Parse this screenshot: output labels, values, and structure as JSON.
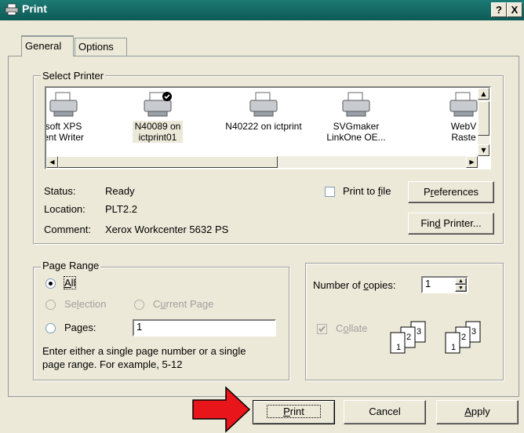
{
  "window": {
    "title": "Print",
    "help_label": "?",
    "close_label": "X"
  },
  "tabs": [
    {
      "label": "General"
    },
    {
      "label": "Options"
    }
  ],
  "select_printer": {
    "legend": "Select Printer",
    "printers": [
      {
        "line1": "soft XPS",
        "line2": "ent Writer",
        "icon": "printer-icon"
      },
      {
        "line1": "N40089 on",
        "line2": "ictprint01",
        "icon": "default-printer-icon",
        "selected": true
      },
      {
        "line1": "N40222 on ictprint",
        "line2": "",
        "icon": "printer-icon"
      },
      {
        "line1": "SVGmaker",
        "line2": "LinkOne OE...",
        "icon": "printer-icon"
      },
      {
        "line1": "WebV",
        "line2": "Raste",
        "icon": "printer-icon"
      }
    ],
    "status_label": "Status:",
    "status_value": "Ready",
    "location_label": "Location:",
    "location_value": "PLT2.2",
    "comment_label": "Comment:",
    "comment_value": "Xerox Workcenter 5632 PS",
    "print_to_file_pre": "Print to ",
    "print_to_file_key": "f",
    "print_to_file_post": "ile",
    "preferences_pre": "P",
    "preferences_key": "r",
    "preferences_post": "eferences",
    "find_pre": "Fin",
    "find_key": "d",
    "find_post": " Printer..."
  },
  "page_range": {
    "legend": "Page Range",
    "all_key": "A",
    "all_post": "ll",
    "selection_pre": "Se",
    "selection_key": "l",
    "selection_post": "ection",
    "current_pre": "C",
    "current_key": "u",
    "current_post": "rrent Page",
    "pages_pre": "Pa",
    "pages_key": "g",
    "pages_post": "es:",
    "pages_value": "1",
    "hint_line1": "Enter either a single page number or a single",
    "hint_line2": "page range.  For example, 5-12"
  },
  "copies": {
    "label_pre": "Number of ",
    "label_key": "c",
    "label_post": "opies:",
    "value": "1",
    "collate_pre": "C",
    "collate_key": "o",
    "collate_post": "llate",
    "collate_pages": [
      "1",
      "2",
      "3"
    ]
  },
  "buttons": {
    "print_key": "P",
    "print_post": "rint",
    "cancel": "Cancel",
    "apply_key": "A",
    "apply_post": "pply"
  },
  "colors": {
    "title_bar": "#1c7a74",
    "arrow": "#e8151b",
    "face": "#ece9d8"
  }
}
